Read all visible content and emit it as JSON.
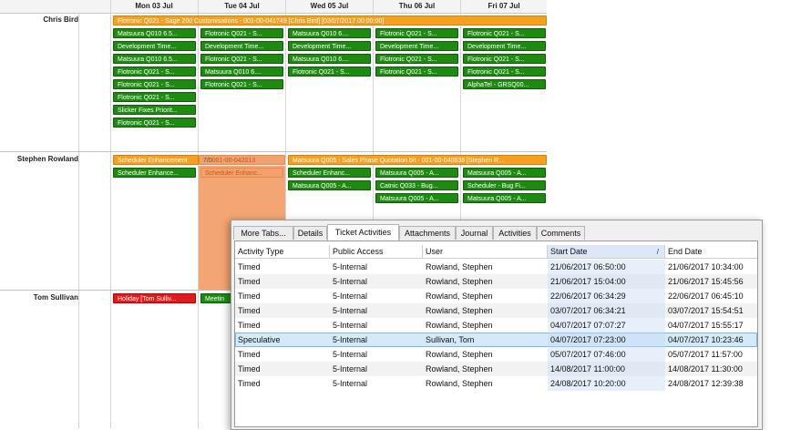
{
  "scheduler": {
    "days": [
      "Mon 03 Jul",
      "Tue 04 Jul",
      "Wed 05 Jul",
      "Thu 06 Jul",
      "Fri 07 Jul"
    ],
    "resources": [
      "Chris Bird",
      "Stephen Rowland",
      "Tom Sullivan"
    ],
    "chris_banner": "Flotronic Q021 - Sage 200 Customisations - 001-00-041749 [Chris Bird] [03/07/2017 00:00:00]",
    "chris": {
      "mon": [
        "Matsuura Q010 6.5...",
        "Development Time...",
        "Matsuura Q010 6.5...",
        "Flotronic Q021 - S...",
        "Flotronic Q021 - S...",
        "Flotronic Q021 - S...",
        "Slicker Fixes Priorit...",
        "Flotronic Q021 - S..."
      ],
      "tue": [
        "Flotronic Q021 - S...",
        "Development Time...",
        "Flotronic Q021 - S...",
        "Matsuura Q010 6....",
        "Flotronic Q021 - S..."
      ],
      "wed": [
        "Matsuura Q010 6....",
        "Development Time...",
        "Matsuura Q010 6....",
        "Flotronic Q021 - S..."
      ],
      "thu": [
        "Flotronic Q021 - S...",
        "Development Time...",
        "Flotronic Q021 - S...",
        "Flotronic Q021 - S..."
      ],
      "fri": [
        "Flotronic Q021 - S...",
        "Development Time...",
        "Flotronic Q021 - S...",
        "Flotronic Q021 - S...",
        "AlphaTel - GRSQ00..."
      ]
    },
    "stephen": {
      "mon_tue_banner": "Scheduler Enhancement",
      "tue_banner_tail": "001-00-042013",
      "tue_banner_mark": "7/0",
      "wed_fri_banner": "Matsuura Q005 - Sales Phase Quotation bit - 001-00-040838 [Stephen R...",
      "mon": [
        "Scheduler Enhance..."
      ],
      "tue": [
        "Scheduler Enhanc..."
      ],
      "wed": [
        "Scheduler Enhanc...",
        "Matsuura Q005 - A..."
      ],
      "thu": [
        "Matsuura Q005 - A...",
        "Catnic Q033 - Bug...",
        "Matsuura Q005 - A..."
      ],
      "fri": [
        "Matsuura Q005 - A...",
        "Scheduler - Bug Fi...",
        "Matsuura Q005 - A..."
      ]
    },
    "tom": {
      "mon": "Holiday [Tom Sulliv...",
      "tue": "Meetin"
    }
  },
  "panel": {
    "tabs": [
      "More Tabs...",
      "Details",
      "Ticket Activities",
      "Attachments",
      "Journal",
      "Activities",
      "Comments"
    ],
    "columns": [
      "Activity Type",
      "Public Access",
      "User",
      "Start Date",
      "End Date"
    ],
    "sort_glyph": "/",
    "rows": [
      [
        "Timed",
        "5-Internal",
        "Rowland, Stephen",
        "21/06/2017 06:50:00",
        "21/06/2017 10:34:00"
      ],
      [
        "Timed",
        "5-Internal",
        "Rowland, Stephen",
        "21/06/2017 15:04:00",
        "21/06/2017 15:45:56"
      ],
      [
        "Timed",
        "5-Internal",
        "Rowland, Stephen",
        "22/06/2017 06:34:29",
        "22/06/2017 06:45:10"
      ],
      [
        "Timed",
        "5-Internal",
        "Rowland, Stephen",
        "03/07/2017 06:34:21",
        "03/07/2017 15:54:51"
      ],
      [
        "Timed",
        "5-Internal",
        "Rowland, Stephen",
        "04/07/2017 07:07:27",
        "04/07/2017 15:55:17"
      ],
      [
        "Speculative",
        "5-Internal",
        "Sullivan, Tom",
        "04/07/2017 07:23:00",
        "04/07/2017 10:23:46"
      ],
      [
        "Timed",
        "5-Internal",
        "Rowland, Stephen",
        "05/07/2017 07:46:00",
        "05/07/2017 11:57:00"
      ],
      [
        "Timed",
        "5-Internal",
        "Rowland, Stephen",
        "14/08/2017 11:00:00",
        "14/08/2017 11:30:00"
      ],
      [
        "Timed",
        "5-Internal",
        "Rowland, Stephen",
        "24/08/2017 10:20:00",
        "24/08/2017 12:39:38"
      ]
    ]
  }
}
